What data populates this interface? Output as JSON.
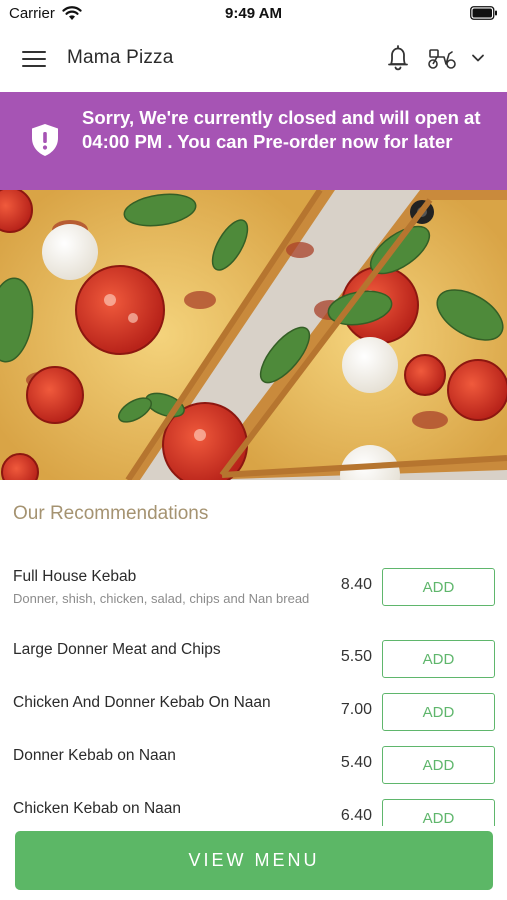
{
  "status_bar": {
    "carrier": "Carrier",
    "time": "9:49 AM",
    "icons": [
      "wifi-icon",
      "battery-icon"
    ]
  },
  "header": {
    "title": "Mama Pizza",
    "icons": [
      "hamburger-icon",
      "bell-icon",
      "scooter-icon",
      "chevron-down-icon"
    ]
  },
  "closed_banner": {
    "message": "Sorry, We're currently closed and will open at 04:00 PM . You can Pre-order now for later",
    "icon": "shield-alert-icon",
    "background": "#a654b4"
  },
  "hero": {
    "icon": "pizza-hero-image"
  },
  "recommendations": {
    "title": "Our Recommendations",
    "items": [
      {
        "name": "Full House Kebab",
        "description": "Donner, shish, chicken, salad, chips and Nan bread",
        "price": "8.40",
        "button": "ADD"
      },
      {
        "name": "Large Donner Meat and Chips",
        "description": "",
        "price": "5.50",
        "button": "ADD"
      },
      {
        "name": "Chicken And Donner Kebab On Naan",
        "description": "",
        "price": "7.00",
        "button": "ADD"
      },
      {
        "name": "Donner Kebab on Naan",
        "description": "",
        "price": "5.40",
        "button": "ADD"
      },
      {
        "name": "Chicken Kebab on Naan",
        "description": "",
        "price": "6.40",
        "button": "ADD"
      }
    ]
  },
  "footer": {
    "view_menu_label": "VIEW MENU"
  },
  "colors": {
    "accent_green": "#5cb766",
    "banner_purple": "#a654b4",
    "section_title": "#a59371"
  }
}
